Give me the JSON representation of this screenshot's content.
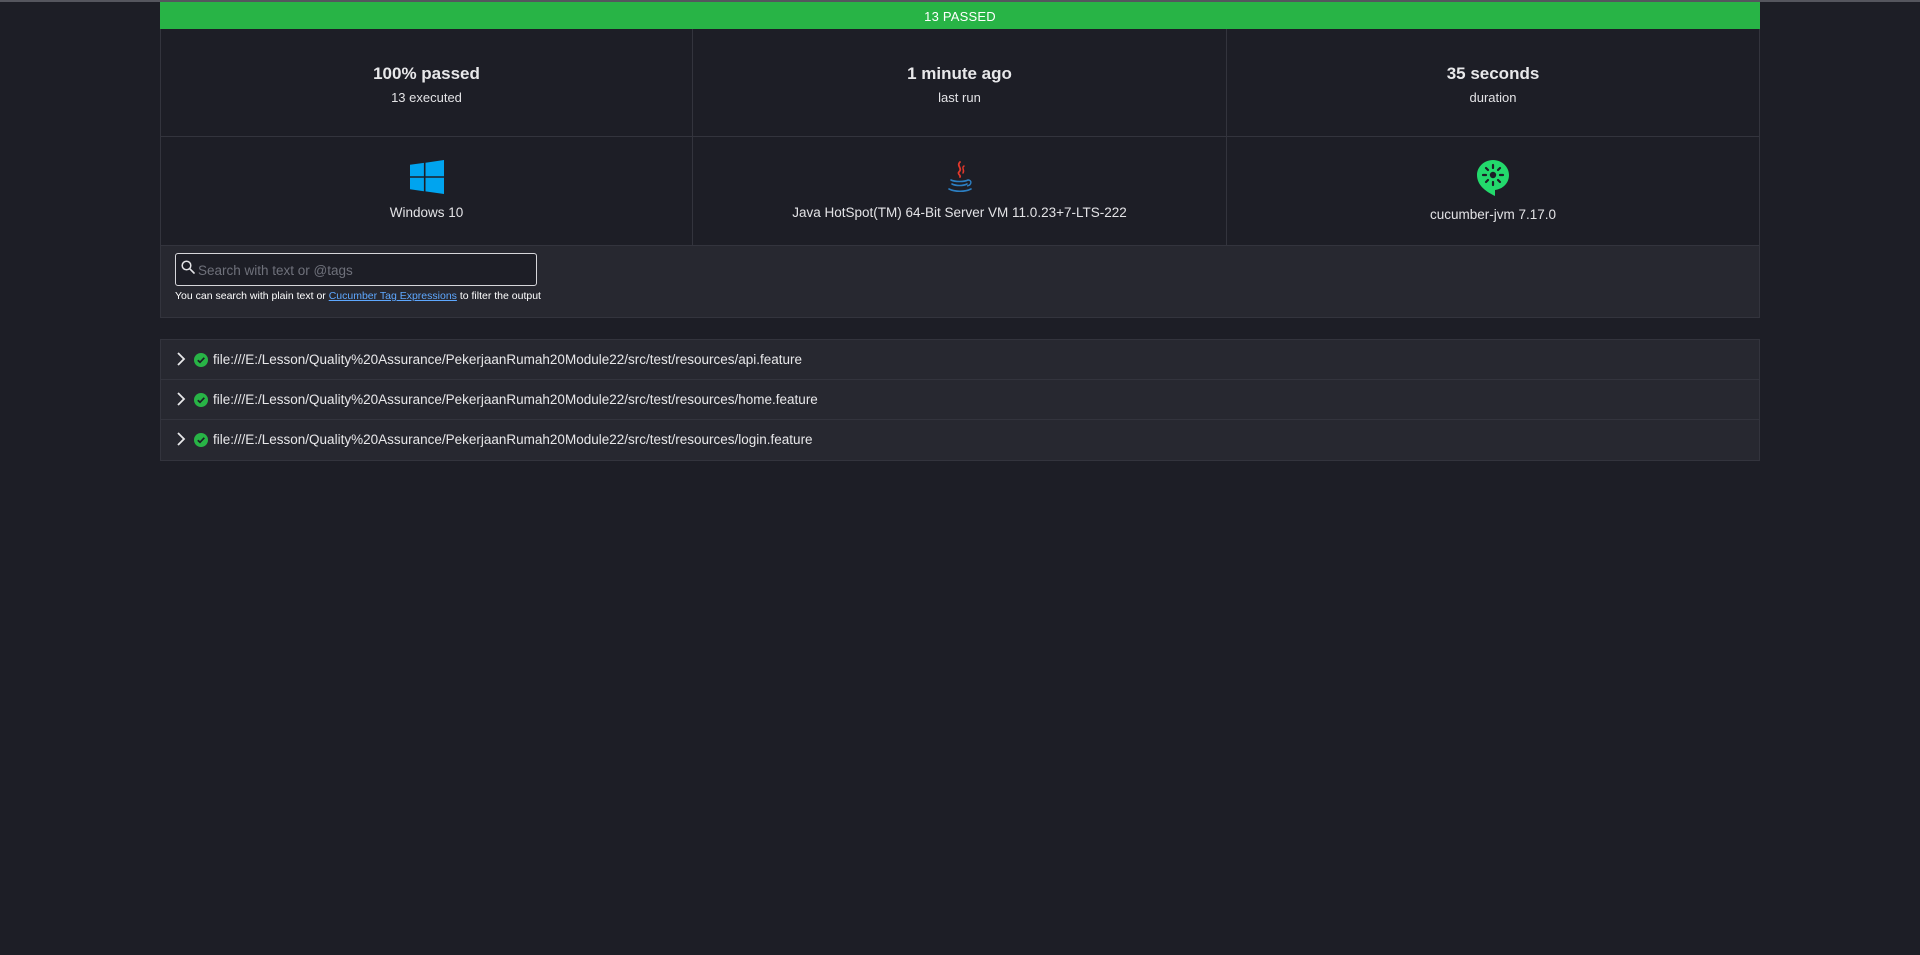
{
  "banner": {
    "text": "13 PASSED",
    "color": "#28b446"
  },
  "stats": [
    {
      "value": "100% passed",
      "label": "13 executed"
    },
    {
      "value": "1 minute ago",
      "label": "last run"
    },
    {
      "value": "35 seconds",
      "label": "duration"
    }
  ],
  "environment": {
    "os": {
      "label": "Windows 10",
      "icon": "windows-icon"
    },
    "runtime": {
      "label": "Java HotSpot(TM) 64-Bit Server VM 11.0.23+7-LTS-222",
      "icon": "java-icon"
    },
    "implementation": {
      "label": "cucumber-jvm 7.17.0",
      "icon": "cucumber-icon"
    }
  },
  "search": {
    "placeholder": "Search with text or @tags",
    "value": "",
    "hint_prefix": "You can search with plain text or ",
    "hint_link": "Cucumber Tag Expressions",
    "hint_suffix": " to filter the output"
  },
  "features": [
    {
      "uri": "file:///E:/Lesson/Quality%20Assurance/PekerjaanRumah20Module22/src/test/resources/api.feature",
      "status": "passed"
    },
    {
      "uri": "file:///E:/Lesson/Quality%20Assurance/PekerjaanRumah20Module22/src/test/resources/home.feature",
      "status": "passed"
    },
    {
      "uri": "file:///E:/Lesson/Quality%20Assurance/PekerjaanRumah20Module22/src/test/resources/login.feature",
      "status": "passed"
    }
  ]
}
